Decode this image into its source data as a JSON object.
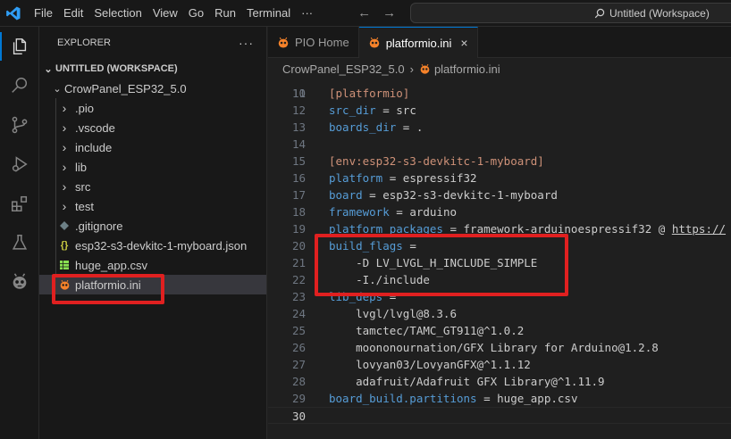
{
  "menu": [
    "File",
    "Edit",
    "Selection",
    "View",
    "Go",
    "Run",
    "Terminal",
    "···"
  ],
  "command_center": "Untitled (Workspace)",
  "explorer": {
    "title": "EXPLORER",
    "more": "···",
    "workspace": "UNTITLED (WORKSPACE)",
    "project": "CrowPanel_ESP32_5.0",
    "items": [
      {
        "label": ".pio",
        "kind": "folder"
      },
      {
        "label": ".vscode",
        "kind": "folder"
      },
      {
        "label": "include",
        "kind": "folder"
      },
      {
        "label": "lib",
        "kind": "folder"
      },
      {
        "label": "src",
        "kind": "folder"
      },
      {
        "label": "test",
        "kind": "folder"
      },
      {
        "label": ".gitignore",
        "kind": "gitignore"
      },
      {
        "label": "esp32-s3-devkitc-1-myboard.json",
        "kind": "json"
      },
      {
        "label": "huge_app.csv",
        "kind": "csv"
      },
      {
        "label": "platformio.ini",
        "kind": "pio"
      }
    ]
  },
  "tabs": [
    {
      "label": "PIO Home",
      "active": false
    },
    {
      "label": "platformio.ini",
      "active": true,
      "close": "×"
    }
  ],
  "breadcrumb": [
    "CrowPanel_ESP32_5.0",
    "platformio.ini"
  ],
  "breadcrumb_sep": "›",
  "editor": {
    "top_partial_number": "10",
    "lines": [
      {
        "n": "11",
        "parts": [
          {
            "t": "[platformio]",
            "c": "sec"
          }
        ]
      },
      {
        "n": "12",
        "parts": [
          {
            "t": "src_dir",
            "c": "key"
          },
          {
            "t": " = ",
            "c": "eq"
          },
          {
            "t": "src",
            "c": "val"
          }
        ]
      },
      {
        "n": "13",
        "parts": [
          {
            "t": "boards_dir",
            "c": "key"
          },
          {
            "t": " = ",
            "c": "eq"
          },
          {
            "t": ".",
            "c": "val"
          }
        ]
      },
      {
        "n": "14",
        "parts": []
      },
      {
        "n": "15",
        "parts": [
          {
            "t": "[env:esp32-s3-devkitc-1-myboard]",
            "c": "sec"
          }
        ]
      },
      {
        "n": "16",
        "parts": [
          {
            "t": "platform",
            "c": "key"
          },
          {
            "t": " = ",
            "c": "eq"
          },
          {
            "t": "espressif32",
            "c": "val"
          }
        ]
      },
      {
        "n": "17",
        "parts": [
          {
            "t": "board",
            "c": "key"
          },
          {
            "t": " = ",
            "c": "eq"
          },
          {
            "t": "esp32-s3-devkitc-1-myboard",
            "c": "val"
          }
        ]
      },
      {
        "n": "18",
        "parts": [
          {
            "t": "framework",
            "c": "key"
          },
          {
            "t": " = ",
            "c": "eq"
          },
          {
            "t": "arduino",
            "c": "val"
          }
        ]
      },
      {
        "n": "19",
        "parts": [
          {
            "t": "platform_packages",
            "c": "key"
          },
          {
            "t": " = ",
            "c": "eq"
          },
          {
            "t": "framework-arduinoespressif32 @ ",
            "c": "val"
          },
          {
            "t": "https://",
            "c": "url"
          }
        ]
      },
      {
        "n": "20",
        "parts": [
          {
            "t": "build_flags",
            "c": "key"
          },
          {
            "t": " =",
            "c": "eq"
          }
        ]
      },
      {
        "n": "21",
        "parts": [
          {
            "t": "    -D LV_LVGL_H_INCLUDE_SIMPLE",
            "c": "val"
          }
        ]
      },
      {
        "n": "22",
        "parts": [
          {
            "t": "    -I./include",
            "c": "val"
          }
        ]
      },
      {
        "n": "23",
        "parts": [
          {
            "t": "lib_deps",
            "c": "key"
          },
          {
            "t": " =",
            "c": "eq"
          }
        ]
      },
      {
        "n": "24",
        "parts": [
          {
            "t": "    lvgl/lvgl@8.3.6",
            "c": "val"
          }
        ]
      },
      {
        "n": "25",
        "parts": [
          {
            "t": "    tamctec/TAMC_GT911@^1.0.2",
            "c": "val"
          }
        ]
      },
      {
        "n": "26",
        "parts": [
          {
            "t": "    moononournation/GFX Library for Arduino@1.2.8",
            "c": "val"
          }
        ]
      },
      {
        "n": "27",
        "parts": [
          {
            "t": "    lovyan03/LovyanGFX@^1.1.12",
            "c": "val"
          }
        ]
      },
      {
        "n": "28",
        "parts": [
          {
            "t": "    adafruit/Adafruit GFX Library@^1.11.9",
            "c": "val"
          }
        ]
      },
      {
        "n": "29",
        "parts": [
          {
            "t": "board_build.partitions",
            "c": "key"
          },
          {
            "t": " = ",
            "c": "eq"
          },
          {
            "t": "huge_app.csv",
            "c": "val"
          }
        ]
      },
      {
        "n": "30",
        "parts": [],
        "current": true
      }
    ]
  },
  "colors": {
    "highlight": "#e02020",
    "accent": "#0078d4",
    "pio_orange": "#f5822a"
  }
}
